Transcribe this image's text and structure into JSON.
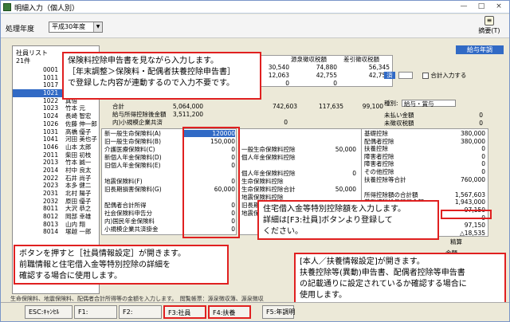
{
  "window": {
    "title": "明細入力（個人別）",
    "minimize": "—",
    "maximize": "□",
    "close": "×"
  },
  "toolbar": {
    "year_label": "処理年度",
    "year_value": "平成30年度",
    "summary_label": "摘要(T)"
  },
  "employee_panel": {
    "title": "社員リスト",
    "count": "21件",
    "rows": [
      {
        "code": "0001",
        "name": ""
      },
      {
        "code": "1011",
        "name": ""
      },
      {
        "code": "1017",
        "name": ""
      },
      {
        "code": "1021",
        "name": ""
      },
      {
        "code": "1022",
        "name": "真悟"
      },
      {
        "code": "1023",
        "name": "竹本 元"
      },
      {
        "code": "1024",
        "name": "長崎 智宏"
      },
      {
        "code": "1026",
        "name": "佐藤 伸一郎"
      },
      {
        "code": "1031",
        "name": "高橋 優子"
      },
      {
        "code": "1041",
        "name": "河田 美也子"
      },
      {
        "code": "1046",
        "name": "山本 太郎"
      },
      {
        "code": "2011",
        "name": "柴田 初枝"
      },
      {
        "code": "2013",
        "name": "竹本 誠一"
      },
      {
        "code": "2014",
        "name": "村中 良太"
      },
      {
        "code": "2022",
        "name": "石井 尚子"
      },
      {
        "code": "2023",
        "name": "本多 健二"
      },
      {
        "code": "2031",
        "name": "北村 陽子"
      },
      {
        "code": "2032",
        "name": "原田 優子"
      },
      {
        "code": "8011",
        "name": "大沢 恭之"
      },
      {
        "code": "8012",
        "name": "岡部 幸雄"
      },
      {
        "code": "8013",
        "name": "山内 翔"
      },
      {
        "code": "8014",
        "name": "塚越 一郎"
      }
    ]
  },
  "main": {
    "tab_label": "給与年調",
    "top_headers": [
      "保険料",
      "源泉徴収税額",
      "差引徴収税額"
    ],
    "top_rows": [
      [
        "30,540",
        "74,880",
        "56,345"
      ],
      [
        "12,063",
        "42,755",
        "42,755"
      ],
      [
        "0",
        "0",
        ""
      ]
    ],
    "totals": {
      "label": "合計",
      "v1": "5,064,000",
      "v2": "742,603",
      "v3": "117,635",
      "v4": "99,100"
    },
    "kyuyo_label": "給与所得控除後金額",
    "kyuyo_value": "3,511,200",
    "shokibo_label": "内)小規模企業共済",
    "shokibo_value": "0",
    "type_label": "種別:",
    "type_value": "給与・賞与",
    "unpaid_label": "未払い金額",
    "unpaid_value": "0",
    "uncollected_label": "未徴収税額",
    "uncollected_value": "0",
    "tax_checkbox_label": "合計入力する",
    "sumi_label": "済",
    "insurance_items": [
      {
        "label": "新一般生命保険料(A)",
        "value": "120000"
      },
      {
        "label": "旧一般生命保険料(B)",
        "value": "150,000"
      },
      {
        "label": "介護医療保険料(C)",
        "value": "0"
      },
      {
        "label": "新個人年金保険料(D)",
        "value": "0"
      },
      {
        "label": "旧個人年金保険料(E)",
        "value": "0"
      },
      {
        "label": "",
        "value": ""
      },
      {
        "label": "地震保険料(F)",
        "value": "0"
      },
      {
        "label": "旧長期損害保険料(G)",
        "value": "60,000"
      },
      {
        "label": "",
        "value": ""
      },
      {
        "label": "配偶者合計所得",
        "value": "0"
      },
      {
        "label": "社会保険料申告分",
        "value": "0"
      },
      {
        "label": "内)国民年金保険料",
        "value": "0"
      },
      {
        "label": "小規模企業共済掛金",
        "value": "0"
      }
    ],
    "middle_items": [
      {
        "label": "",
        "value": ""
      },
      {
        "label": "",
        "value": ""
      },
      {
        "label": "一般生命保険料控除",
        "value": "50,000"
      },
      {
        "label": "個人年金保険料控除",
        "value": ""
      },
      {
        "label": "",
        "value": ""
      },
      {
        "label": "個人年金保険料控除",
        "value": "0"
      },
      {
        "label": "生命保険料控除",
        "value": ""
      },
      {
        "label": "生命保険料控除合計",
        "value": "50,000"
      },
      {
        "label": "地震保険料控除",
        "value": ""
      },
      {
        "label": "旧長期損害保険料控除",
        "value": "15,000"
      },
      {
        "label": "地震保険料控除計",
        "value": "15,000"
      }
    ],
    "right_items": [
      {
        "label": "基礎控除",
        "value": "380,000"
      },
      {
        "label": "配偶者控除",
        "value": "380,000"
      },
      {
        "label": "扶養控除",
        "value": "0"
      },
      {
        "label": "障害者控除",
        "value": "0"
      },
      {
        "label": "障害者控除",
        "value": "0"
      },
      {
        "label": "その他控除",
        "value": "0"
      },
      {
        "label": "扶養控除等合計",
        "value": "760,000"
      },
      {
        "label": "",
        "value": ""
      },
      {
        "label": "所得控除額の合計額",
        "value": "1,567,603"
      },
      {
        "label": "差引課税給与所得金額",
        "value": "1,943,000"
      },
      {
        "label": "",
        "value": "97,150"
      },
      {
        "label": "",
        "value": "0"
      },
      {
        "label": "",
        "value": "97,150"
      },
      {
        "label": "",
        "value": "△18,535"
      }
    ],
    "seisan_label": "精算",
    "gaku_label": "金額"
  },
  "callouts": {
    "top": [
      "保険料控除申告書を見ながら入力します。",
      "［年末調整＞保険料・配偶者扶養控除申告書］",
      "で登録した内容が連動するので入力不要です。"
    ],
    "housing": [
      "住宅借入金等特別控除額を入力します。",
      "詳細は[F3:社員]ボタンより登録して",
      "ください。"
    ],
    "bottom_left": [
      "ボタンを押すと［社員情報設定］が開きます。",
      "前職情報と住宅借入金等特別控除の詳細を",
      "確認する場合に使用します。"
    ],
    "bottom_right": [
      "[本人／扶養情報設定]が開きます。",
      "扶養控除等(異動)申告書、配偶者控除等申告書",
      "の記載通りに設定されているか確認する場合に",
      "使用します。"
    ]
  },
  "status_text": "生命保険料、地震保険料、配偶者合計所得等の金額を入力します。　閲覧帳票：源泉徴収簿、源泉徴収",
  "function_keys": [
    {
      "label": "ESC:ｷｬﾝｾﾙ"
    },
    {
      "label": "F1:"
    },
    {
      "label": "F2:"
    },
    {
      "label": "F3:社員"
    },
    {
      "label": "F4:扶養"
    },
    {
      "label": "F5:年調明"
    }
  ]
}
